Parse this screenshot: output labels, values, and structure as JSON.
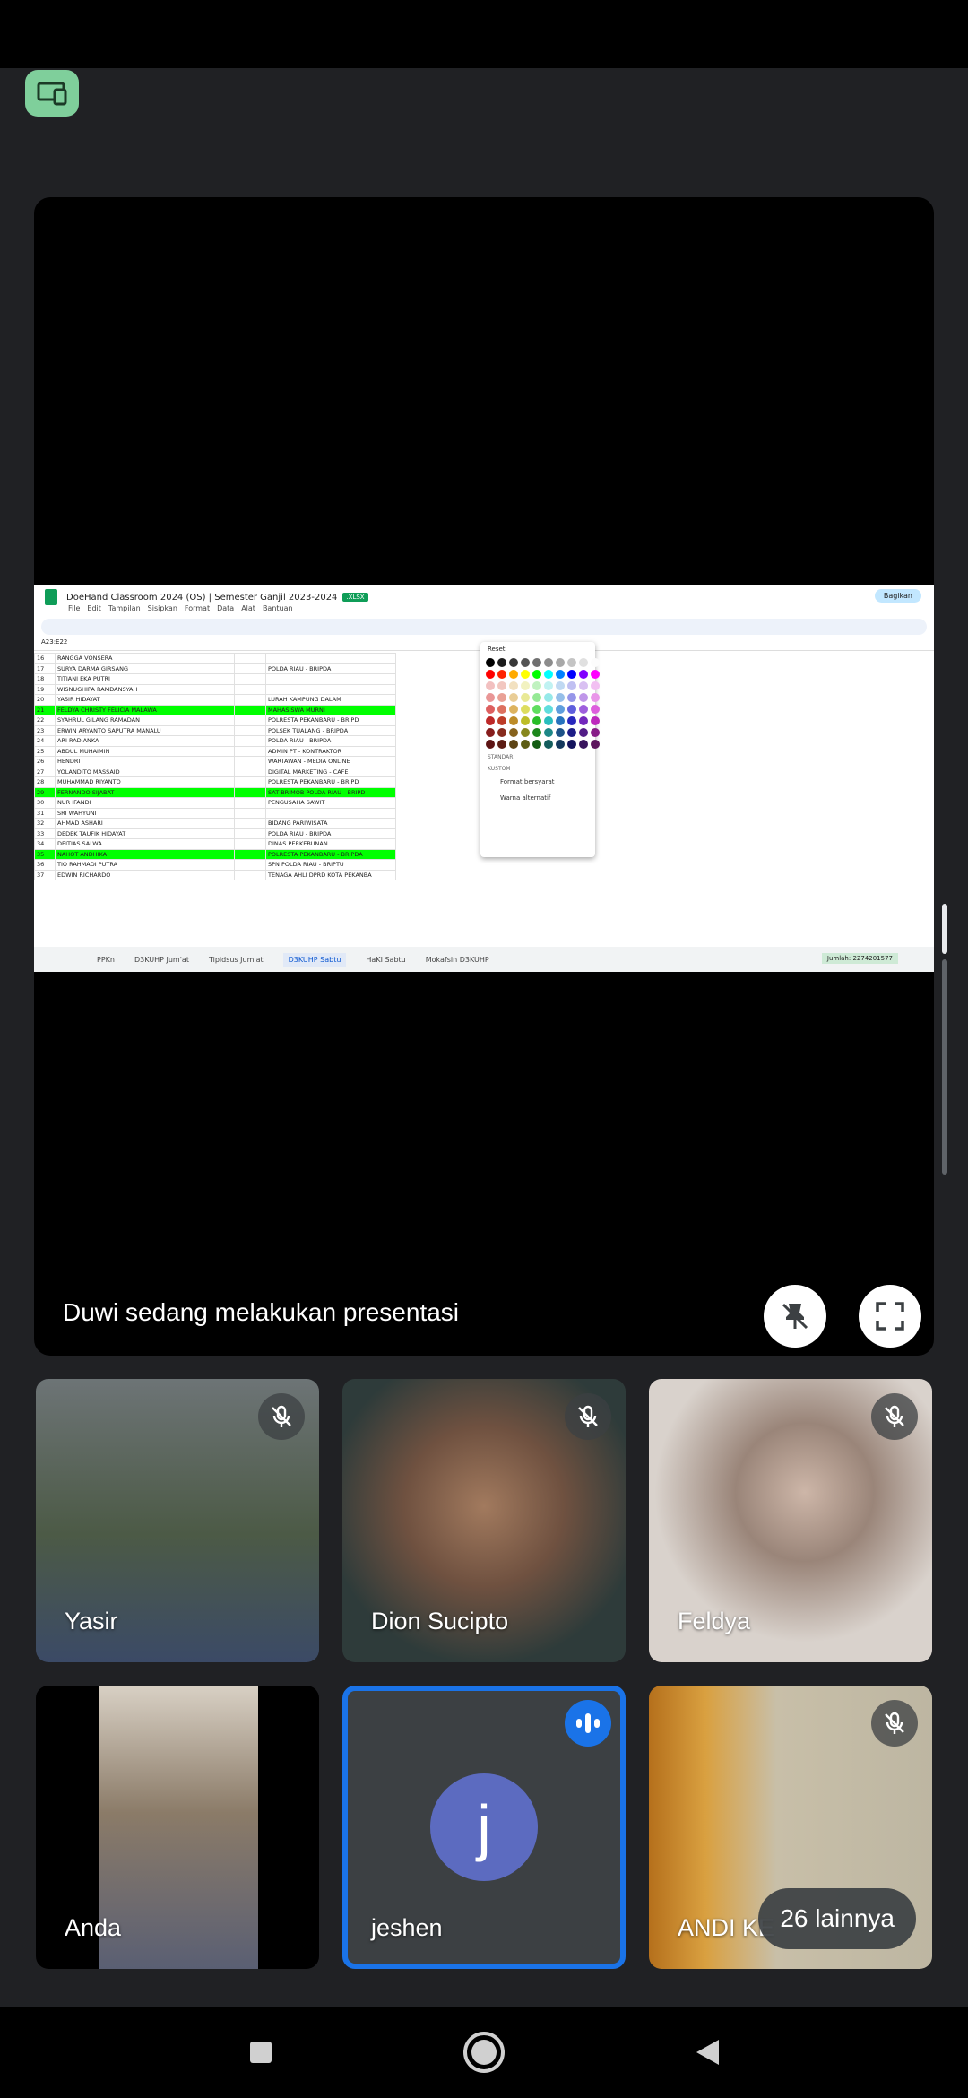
{
  "presentation": {
    "presenter_text": "Duwi sedang melakukan presentasi",
    "shared_screen": {
      "doc_title": "DoeHand Classroom 2024 (OS) | Semester Ganjil 2023-2024",
      "file_badge": ".XLSX",
      "share_label": "Bagikan",
      "menu": [
        "File",
        "Edit",
        "Tampilan",
        "Sisipkan",
        "Format",
        "Data",
        "Alat",
        "Bantuan"
      ],
      "cell_ref": "A23:E22",
      "rows": [
        {
          "n": "16",
          "name": "RANGGA VONSERA",
          "job": ""
        },
        {
          "n": "17",
          "name": "SURYA DARMA GIRSANG",
          "job": "POLDA RIAU - BRIPDA"
        },
        {
          "n": "18",
          "name": "TITIANI EKA PUTRI",
          "job": ""
        },
        {
          "n": "19",
          "name": "WISNUGHIPA RAMDANSYAH",
          "job": ""
        },
        {
          "n": "20",
          "name": "YASIR HIDAYAT",
          "job": "LURAH KAMPUNG DALAM"
        },
        {
          "n": "21",
          "name": "FELDYA CHRISTY FELICIA MALAWA",
          "job": "MAHASISWA MURNI",
          "hl": true
        },
        {
          "n": "22",
          "name": "SYAHRUL GILANG RAMADAN",
          "job": "POLRESTA PEKANBARU - BRIPD"
        },
        {
          "n": "23",
          "name": "ERWIN ARYANTO SAPUTRA MANALU",
          "job": "POLSEK TUALANG - BRIPDA"
        },
        {
          "n": "24",
          "name": "ARI RADIANKA",
          "job": "POLDA RIAU - BRIPDA"
        },
        {
          "n": "25",
          "name": "ABDUL MUHAIMIN",
          "job": "ADMIN PT - KONTRAKTOR"
        },
        {
          "n": "26",
          "name": "HENDRI",
          "job": "WARTAWAN - MEDIA ONLINE"
        },
        {
          "n": "27",
          "name": "YOLANDITO MASSAID",
          "job": "DIGITAL MARKETING - CAFE"
        },
        {
          "n": "28",
          "name": "MUHAMMAD RIYANTO",
          "job": "POLRESTA PEKANBARU - BRIPD"
        },
        {
          "n": "29",
          "name": "FERNANDO SIJABAT",
          "job": "SAT BRIMOB POLDA RIAU - BRIPD",
          "hl": true
        },
        {
          "n": "30",
          "name": "NUR IFANDI",
          "job": "PENGUSAHA SAWIT"
        },
        {
          "n": "31",
          "name": "SRI WAHYUNI",
          "job": ""
        },
        {
          "n": "32",
          "name": "AHMAD ASHARI",
          "job": "BIDANG PARIWISATA"
        },
        {
          "n": "33",
          "name": "DEDEK TAUFIK HIDAYAT",
          "job": "POLDA RIAU - BRIPDA"
        },
        {
          "n": "34",
          "name": "DEITIAS SALWA",
          "job": "DINAS PERKEBUNAN"
        },
        {
          "n": "35",
          "name": "NAHOT ANDHIKA",
          "job": "POLRESTA PEKANBARU - BRIPDA",
          "hl": true
        },
        {
          "n": "36",
          "name": "TIO RAHMADI PUTRA",
          "job": "SPN POLDA RIAU - BRIPTU"
        },
        {
          "n": "37",
          "name": "EDWIN RICHARDO",
          "job": "TENAGA AHLI DPRD KOTA PEKANBA"
        }
      ],
      "color_picker": {
        "reset": "Reset",
        "standard": "STANDAR",
        "custom": "KUSTOM",
        "option_1": "Format bersyarat",
        "option_2": "Warna alternatif"
      },
      "tabs": [
        "PPKn",
        "D3KUHP Jum'at",
        "Tipidsus Jum'at",
        "D3KUHP Sabtu",
        "HaKI Sabtu",
        "Mokafsin D3KUHP"
      ],
      "active_tab_index": 3,
      "sum_label": "Jumlah: 2274201577"
    }
  },
  "participants": [
    {
      "name": "Yasir",
      "muted": true
    },
    {
      "name": "Dion Sucipto",
      "muted": true
    },
    {
      "name": "Feldya",
      "muted": true
    },
    {
      "name": "Anda",
      "muted": false
    },
    {
      "name": "jeshen",
      "initial": "j",
      "speaking": true
    },
    {
      "name": "ANDI KE",
      "muted": true
    }
  ],
  "more_label": "26 lainnya",
  "colors": {
    "background": "#202124",
    "accent": "#1a73e8",
    "avatar": "#5c6bc0",
    "cast": "#7fcf9b",
    "highlight": "#00ff00"
  }
}
